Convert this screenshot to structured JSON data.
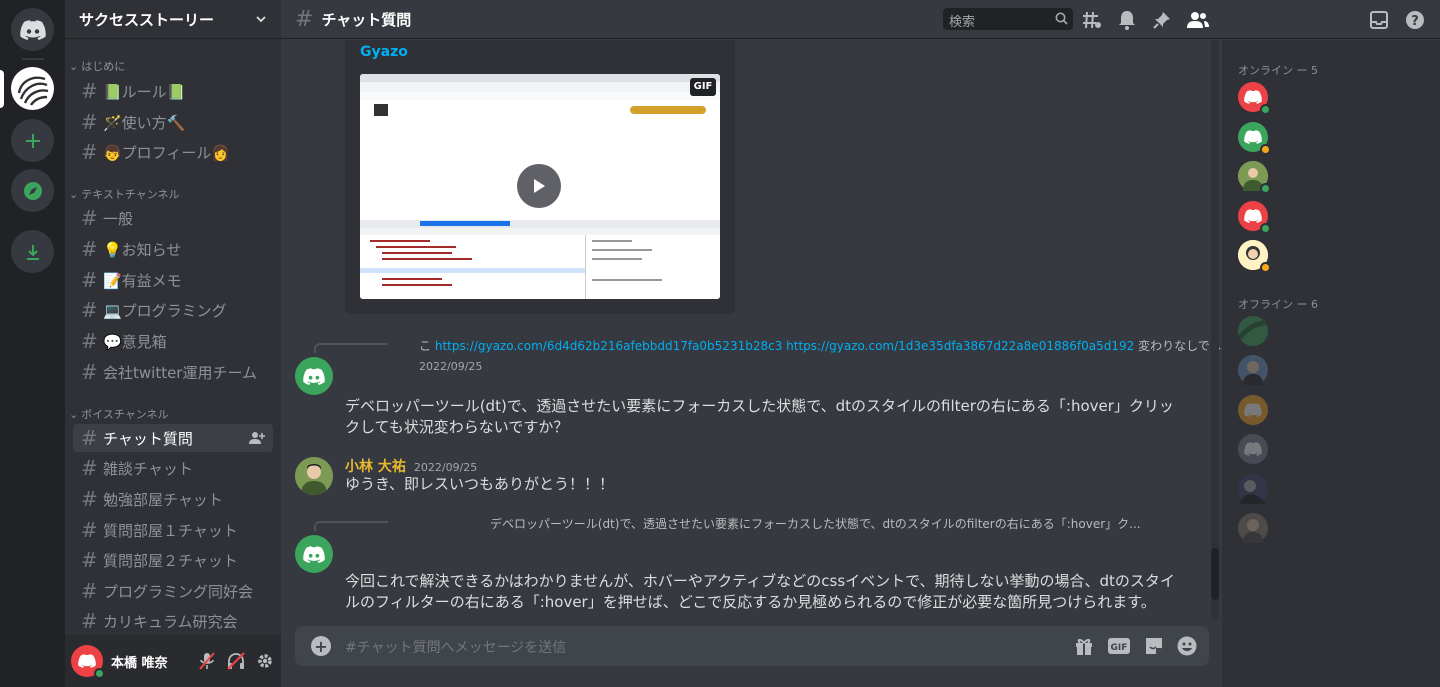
{
  "server": {
    "name": "サクセスストーリー",
    "user_name": "本橋 唯奈"
  },
  "categories": {
    "intro": "はじめに",
    "text": "テキストチャンネル",
    "voice": "ボイスチャンネル"
  },
  "channels": [
    {
      "label": "📗ルール📗"
    },
    {
      "label": "🪄使い方🔨"
    },
    {
      "label": "👦プロフィール👩"
    },
    {
      "label": "一般"
    },
    {
      "label": "💡お知らせ"
    },
    {
      "label": "📝有益メモ"
    },
    {
      "label": "💻プログラミング"
    },
    {
      "label": "💬意見箱"
    },
    {
      "label": "会社twitter運用チーム"
    },
    {
      "label": "チャット質問"
    },
    {
      "label": "雑談チャット"
    },
    {
      "label": "勉強部屋チャット"
    },
    {
      "label": "質問部屋１チャット"
    },
    {
      "label": "質問部屋２チャット"
    },
    {
      "label": "プログラミング同好会"
    },
    {
      "label": "カリキュラム研究会"
    }
  ],
  "topbar": {
    "channel": "チャット質問",
    "search_placeholder": "検索"
  },
  "embed": {
    "provider": "Gyazo",
    "gif_badge": "GIF"
  },
  "messages": [
    {
      "reply_prefix": "こ",
      "reply_link1": "https://gyazo.com/6d4d62b216afebbdd17fa0b5231b28c3",
      "reply_link2": "https://gyazo.com/1d3e35dfa3867d22a8e01886f0a5d192",
      "reply_suffix": " 変わりなしでした",
      "author": "",
      "time": "2022/09/25",
      "body": "デベロッパーツール(dt)で、透過させたい要素にフォーカスした状態で、dtのスタイルのfilterの右にある「:hover」クリックしても状況変わらないですか？"
    },
    {
      "author": "小林 大祐",
      "author_color": "#e7b92e",
      "time": "2022/09/25",
      "body": "ゆうき、即レスいつもありがとう！！！"
    },
    {
      "reply_text": "デベロッパーツール(dt)で、透過させたい要素にフォーカスした状態で、dtのスタイルのfilterの右にある「:hover」ク...",
      "body": "今回これで解決できるかはわかりませんが、ホバーやアクティブなどのcssイベントで、期待しない挙動の場合、dtのスタイルのフィルターの右にある「:hover」を押せば、どこで反応するか見極められるので修正が必要な箇所見つけられます。"
    }
  ],
  "composer": {
    "placeholder": "#チャット質問へメッセージを送信"
  },
  "members": {
    "online_label": "オンライン ー 5",
    "offline_label": "オフライン ー 6"
  },
  "colors": {
    "accent_red": "#ed4245",
    "accent_green": "#3ba55d",
    "link": "#00aff4"
  }
}
